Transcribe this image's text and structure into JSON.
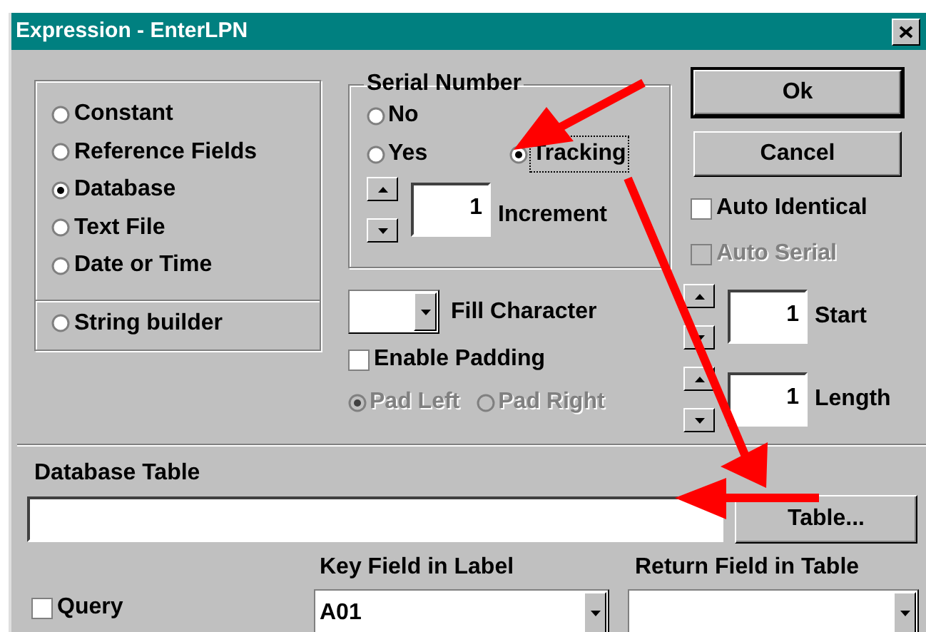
{
  "window": {
    "title": "Expression - EnterLPN"
  },
  "source_options": [
    {
      "label": "Constant",
      "selected": false,
      "kind": "plain"
    },
    {
      "label": "Reference Fields",
      "selected": false,
      "kind": "plain"
    },
    {
      "label": "Database",
      "selected": true,
      "kind": "plain"
    },
    {
      "label": "Text File",
      "selected": false,
      "kind": "plain"
    },
    {
      "label": "Date or Time",
      "selected": false,
      "kind": "plain"
    },
    {
      "label": "String builder",
      "selected": false,
      "kind": "separated"
    }
  ],
  "serial_number": {
    "title": "Serial Number",
    "options": [
      {
        "label": "No",
        "selected": false,
        "focused": false
      },
      {
        "label": "Yes",
        "selected": false,
        "focused": false
      },
      {
        "label": "Tracking",
        "selected": true,
        "focused": true
      }
    ],
    "increment": {
      "value": "1",
      "label": "Increment"
    }
  },
  "fill_character": {
    "label": "Fill Character"
  },
  "enable_padding": {
    "label": "Enable Padding",
    "checked": false
  },
  "padding_options": [
    {
      "label": "Pad Left",
      "selected": true,
      "disabled": true
    },
    {
      "label": "Pad Right",
      "selected": false,
      "disabled": true
    }
  ],
  "buttons": [
    {
      "label": "Ok",
      "default": true
    },
    {
      "label": "Cancel",
      "default": false
    }
  ],
  "auto_options": [
    {
      "label": "Auto Identical",
      "checked": false,
      "disabled": false
    },
    {
      "label": "Auto Serial",
      "checked": false,
      "disabled": true
    }
  ],
  "start": {
    "value": "1",
    "label": "Start"
  },
  "length": {
    "value": "1",
    "label": "Length"
  },
  "database_table": {
    "label": "Database Table",
    "button": "Table..."
  },
  "query": {
    "label": "Query",
    "checked": false
  },
  "key_field": {
    "label": "Key Field in Label",
    "value": "A01"
  },
  "return_field": {
    "label": "Return Field in Table"
  }
}
